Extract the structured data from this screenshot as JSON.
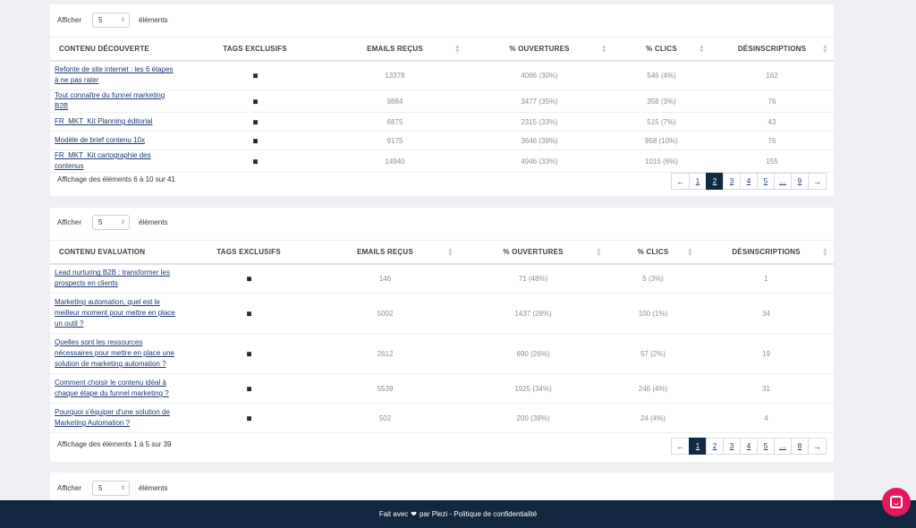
{
  "common": {
    "show_label": "Afficher",
    "elements_label": "éléments",
    "page_size": "5",
    "columns": [
      "CONTENU DÉCOUVERTE",
      "TAGS EXCLUSIFS",
      "EMAILS REÇUS",
      "% OUVERTURES",
      "% CLICS",
      "DÉSINSCRIPTIONS"
    ]
  },
  "table1": {
    "columns": [
      "CONTENU DÉCOUVERTE",
      "TAGS EXCLUSIFS",
      "EMAILS REÇUS",
      "% OUVERTURES",
      "% CLICS",
      "DÉSINSCRIPTIONS"
    ],
    "rows": [
      {
        "title": "Refonte de site internet : les 6 étapes à ne pas rater",
        "emails": "13378",
        "opens": "4066 (30%)",
        "clicks": "546 (4%)",
        "unsub": "162"
      },
      {
        "title": "Tout connaître du funnel marketing B2B",
        "emails": "9884",
        "opens": "3477 (35%)",
        "clicks": "358 (3%)",
        "unsub": "76"
      },
      {
        "title": "FR_MKT_Kit Planning éditorial",
        "emails": "6875",
        "opens": "2315 (33%)",
        "clicks": "515 (7%)",
        "unsub": "43"
      },
      {
        "title": "Modèle de brief contenu 10x",
        "emails": "9175",
        "opens": "3646 (39%)",
        "clicks": "958 (10%)",
        "unsub": "76"
      },
      {
        "title": "FR_MKT_Kit cartographie des contenus",
        "emails": "14940",
        "opens": "4946 (33%)",
        "clicks": "1015 (6%)",
        "unsub": "155"
      }
    ],
    "info": "Affichage des éléments 6 à 10 sur 41",
    "pages": [
      "1",
      "2",
      "3",
      "4",
      "5",
      "…",
      "9"
    ],
    "active_page": "2"
  },
  "table2": {
    "columns": [
      "CONTENU EVALUATION",
      "TAGS EXCLUSIFS",
      "EMAILS REÇUS",
      "% OUVERTURES",
      "% CLICS",
      "DÉSINSCRIPTIONS"
    ],
    "rows": [
      {
        "title": "Lead nurturing B2B : transformer les prospects en clients",
        "emails": "146",
        "opens": "71 (48%)",
        "clicks": "5 (3%)",
        "unsub": "1"
      },
      {
        "title": "Marketing automation, quel est le meilleur moment pour mettre en place un outil ?",
        "emails": "5002",
        "opens": "1437 (28%)",
        "clicks": "100 (1%)",
        "unsub": "34"
      },
      {
        "title": "Quelles sont les ressources nécessaires pour mettre en place une solution de marketing automation ?",
        "emails": "2612",
        "opens": "690 (26%)",
        "clicks": "57 (2%)",
        "unsub": "19"
      },
      {
        "title": "Comment choisir le contenu idéal à chaque étape du funnel marketing ?",
        "emails": "5539",
        "opens": "1925 (34%)",
        "clicks": "246 (4%)",
        "unsub": "31"
      },
      {
        "title": "Pourquoi s'équiper d'une solution de Marketing Automation ?",
        "emails": "502",
        "opens": "200 (39%)",
        "clicks": "24 (4%)",
        "unsub": "4"
      }
    ],
    "info": "Affichage des éléments 1 à 5 sur 39",
    "pages": [
      "1",
      "2",
      "3",
      "4",
      "5",
      "…",
      "8"
    ],
    "active_page": "1"
  },
  "footer": {
    "made_with": "Fait avec",
    "by": "par Plezi - Politique de confidentialité"
  },
  "icons": {
    "tag": "tag-icon",
    "prev": "arrow-left-icon",
    "next": "arrow-right-icon",
    "heart": "heart-icon",
    "chat": "chat-icon"
  },
  "colors": {
    "footer_bg": "#10273f",
    "active_page_bg": "#0f2a45",
    "link": "#1d3a73",
    "chat_button": "#e2195f"
  }
}
